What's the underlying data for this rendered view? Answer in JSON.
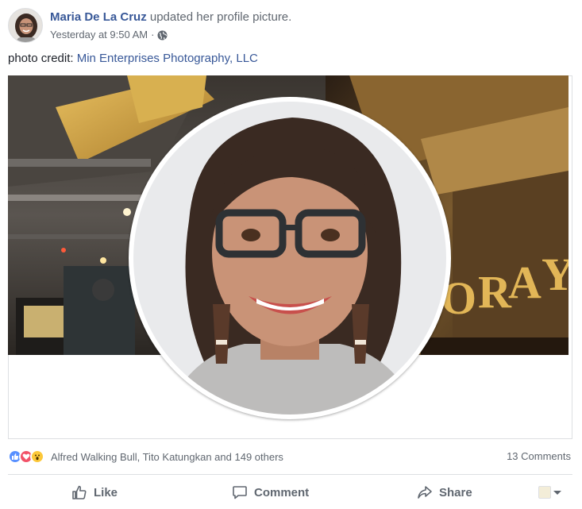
{
  "header": {
    "author_name": "Maria De La Cruz",
    "action_text": " updated her profile picture.",
    "timestamp": "Yesterday at 9:50 AM",
    "separator": "·",
    "privacy_icon": "globe-icon"
  },
  "caption": {
    "prefix": "photo credit: ",
    "link_text": "Min Enterprises Photography, LLC"
  },
  "photo": {
    "cover_icon": "cover-photo",
    "profile_icon": "profile-photo"
  },
  "reactions": {
    "icons": [
      "like-icon",
      "love-icon",
      "wow-icon"
    ],
    "names": "Alfred Walking Bull, Tito Katungkan and 149 others",
    "comments": "13 Comments"
  },
  "actions": {
    "like": "Like",
    "comment": "Comment",
    "share": "Share"
  },
  "colors": {
    "link": "#385898",
    "meta": "#606770",
    "divider": "#dddfe2",
    "like_blue": "#5890ff",
    "love_red": "#f25268",
    "wow_yellow": "#fcc83a"
  }
}
